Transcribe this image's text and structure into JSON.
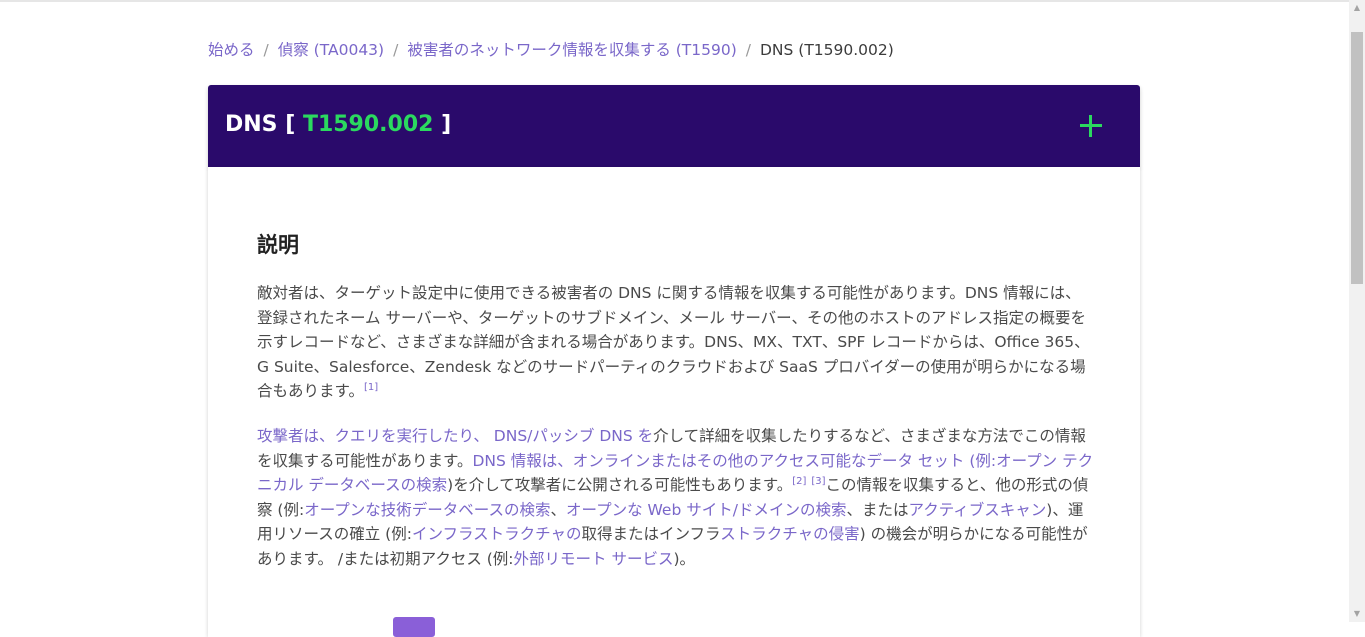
{
  "breadcrumb": {
    "items": [
      "始める",
      "偵察 (TA0043)",
      "被害者のネットワーク情報を収集する (T1590)"
    ],
    "separator": "/",
    "current": "DNS (T1590.002)"
  },
  "technique": {
    "name": "DNS",
    "bracket_open": "[",
    "id": "T1590.002",
    "bracket_close": "]",
    "expand_icon": "plus-icon"
  },
  "description": {
    "heading": "説明",
    "p1_text": "敵対者は、ターゲット設定中に使用できる被害者の DNS に関する情報を収集する可能性があります。DNS 情報には、登録されたネーム サーバーや、ターゲットのサブドメイン、メール サーバー、その他のホストのアドレス指定の概要を示すレコードなど、さまざまな詳細が含まれる場合があります。DNS、MX、TXT、SPF レコードからは、Office 365、G Suite、Salesforce、Zendesk などのサードパーティのクラウドおよび SaaS プロバイダーの使用が明らかになる場合もあります。",
    "p1_ref": "[1]",
    "p2_link1": "攻撃者は、クエリを実行したり、 DNS/パッシブ DNS を",
    "p2_text1": "介して詳細を収集したりするなど、さまざまな方法でこの情報を収集する可能性があります。",
    "p2_link2": "DNS 情報は、オンラインまたはその他のアクセス可能なデータ セット (例:オープン テクニカル データベースの検索",
    "p2_text2": ")を介して攻撃者に公開される可能性もあります。",
    "p2_ref1": "[2]",
    "p2_ref2": "[3]",
    "p2_text3": "この情報を収集すると、他の形式の偵察 (例:",
    "p2_link3": "オープンな技術データベースの検索",
    "p2_text4": "、",
    "p2_link4": "オープンな Web サイト/ドメインの検索",
    "p2_text5": "、または",
    "p2_link5": "アクティブスキャン",
    "p2_text6": ")、運用リソースの確立 (例:",
    "p2_link6": "インフラストラクチャの",
    "p2_text7": "取得またはインフラ",
    "p2_link7": "ストラクチャの侵害",
    "p2_text8": ") の機会が明らかになる可能性があります。 /または初期アクセス (例:",
    "p2_link8": "外部リモート サービス",
    "p2_text9": ")。"
  },
  "colors": {
    "header_bg": "#2a0a6b",
    "technique_id": "#2bd95f",
    "link": "#7a67c9"
  }
}
